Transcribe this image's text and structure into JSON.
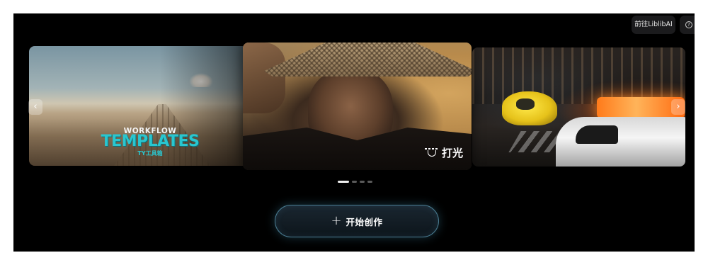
{
  "header": {
    "goto_label": "前往LiblibAI",
    "help_icon": "question-circle-icon"
  },
  "carousel": {
    "slides": [
      {
        "kind": "workflow-templates",
        "line1": "WORKFLOW",
        "line2": "TEMPLATES",
        "line3": "TY工具箱"
      },
      {
        "kind": "relight",
        "label": "打光",
        "icon": "relight-lamp-icon"
      },
      {
        "kind": "street-scene"
      }
    ],
    "active_index": 1,
    "dot_count": 4,
    "prev_glyph": "‹",
    "next_glyph": "›"
  },
  "cta": {
    "icon": "+",
    "label": "开始创作"
  },
  "colors": {
    "background": "#000000",
    "accent_border": "#4a7c92",
    "template_teal": "#29c6cf"
  }
}
